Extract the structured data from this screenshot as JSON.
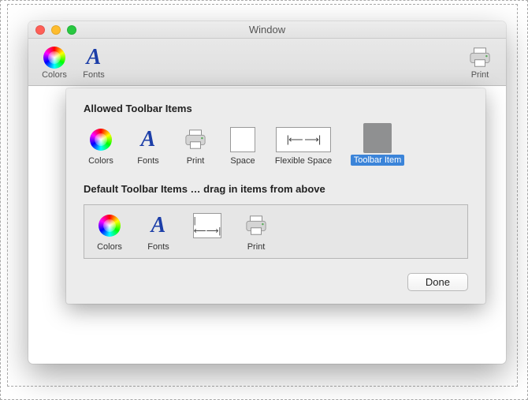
{
  "window": {
    "title": "Window"
  },
  "toolbar": {
    "colors": "Colors",
    "fonts": "Fonts",
    "print": "Print"
  },
  "sheet": {
    "allowed_title": "Allowed Toolbar Items",
    "default_title": "Default Toolbar Items … drag in items from above",
    "items": {
      "colors": "Colors",
      "fonts": "Fonts",
      "print": "Print",
      "space": "Space",
      "flexible_space": "Flexible Space",
      "toolbar_item": "Toolbar Item"
    },
    "done": "Done"
  }
}
